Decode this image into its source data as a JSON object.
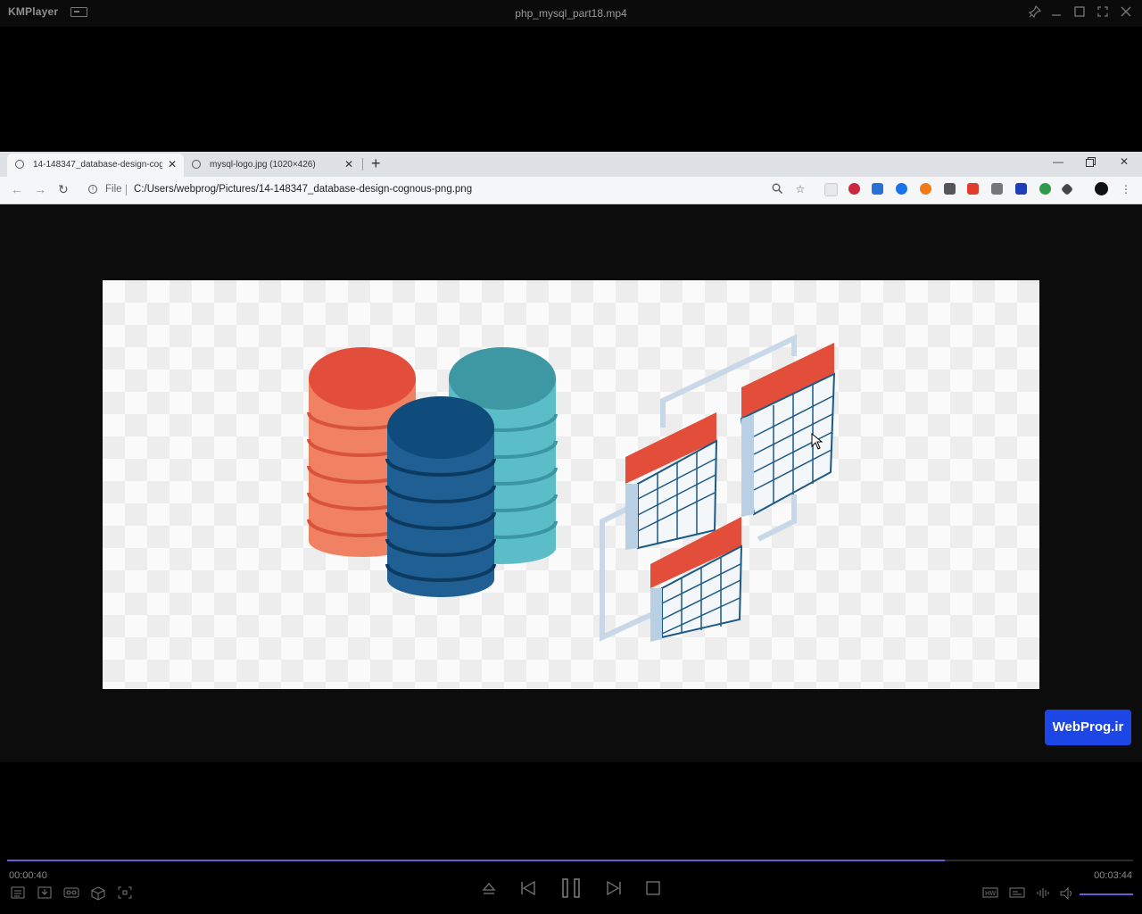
{
  "player": {
    "app_name": "KMPlayer",
    "file_name": "php_mysql_part18.mp4",
    "current_time": "00:00:40",
    "total_time": "00:03:44",
    "progress": 0.833,
    "accent_color": "#6b5bd6",
    "title_buttons": [
      "pin-icon",
      "minimize-icon",
      "restore-icon",
      "fullscreen-icon",
      "close-icon"
    ],
    "left_controls": [
      "playlist-icon",
      "download-icon",
      "vr-icon",
      "3d-icon",
      "capture-icon"
    ],
    "center_controls": [
      "eject-icon",
      "previous-icon",
      "pause-icon",
      "next-icon",
      "stop-icon"
    ],
    "right_controls": [
      "hw-icon",
      "subtitle-icon",
      "equalizer-icon",
      "volume-icon"
    ]
  },
  "browser": {
    "tabs": [
      {
        "title": "14-148347_database-design-cog",
        "active": true
      },
      {
        "title": "mysql-logo.jpg (1020×426)",
        "active": false
      }
    ],
    "new_tab": "+",
    "address": {
      "scheme_label": "File",
      "url": "C:/Users/webprog/Pictures/14-148347_database-design-cognous-png.png"
    }
  },
  "illustration": {
    "subject": "database-design",
    "colors": {
      "red": "#e24e3a",
      "teal": "#4fb3bf",
      "navy": "#0f4c7b",
      "table_line": "#1c5a86"
    }
  },
  "watermark": "WebProg.ir"
}
